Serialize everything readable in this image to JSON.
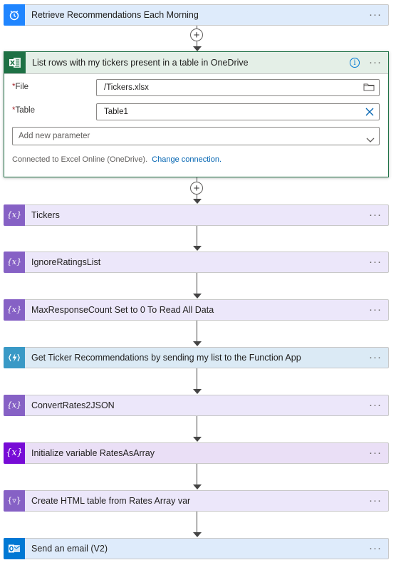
{
  "trigger": {
    "title": "Retrieve Recommendations Each Morning",
    "icon": "alarm-clock-icon"
  },
  "excel_action": {
    "title": "List rows with my tickers present in a table in OneDrive",
    "icon": "excel-icon",
    "file_label": "File",
    "file_value": "/Tickers.xlsx",
    "table_label": "Table",
    "table_value": "Table1",
    "add_parameter_placeholder": "Add new parameter",
    "connected_text": "Connected to Excel Online (OneDrive).",
    "change_connection": "Change connection."
  },
  "steps": [
    {
      "title": "Tickers",
      "icon": "variable-icon"
    },
    {
      "title": "IgnoreRatingsList",
      "icon": "variable-icon"
    },
    {
      "title": "MaxResponseCount Set to 0 To Read All Data",
      "icon": "variable-icon"
    },
    {
      "title": "Get Ticker Recommendations by sending my list to the Function App",
      "icon": "azure-function-icon"
    },
    {
      "title": "ConvertRates2JSON",
      "icon": "variable-icon"
    },
    {
      "title": "Initialize variable RatesAsArray",
      "icon": "initialize-variable-icon"
    },
    {
      "title": "Create HTML table from Rates Array var",
      "icon": "data-operation-icon"
    },
    {
      "title": "Send an email (V2)",
      "icon": "outlook-icon"
    }
  ],
  "more_glyph": "···",
  "plus_glyph": "+",
  "colors": {
    "trigger_icon": "#1f85ff",
    "excel": "#1e7145",
    "variable": "#8661c5",
    "init_variable": "#770bd6",
    "function": "#3999c6",
    "outlook": "#0078d4"
  }
}
